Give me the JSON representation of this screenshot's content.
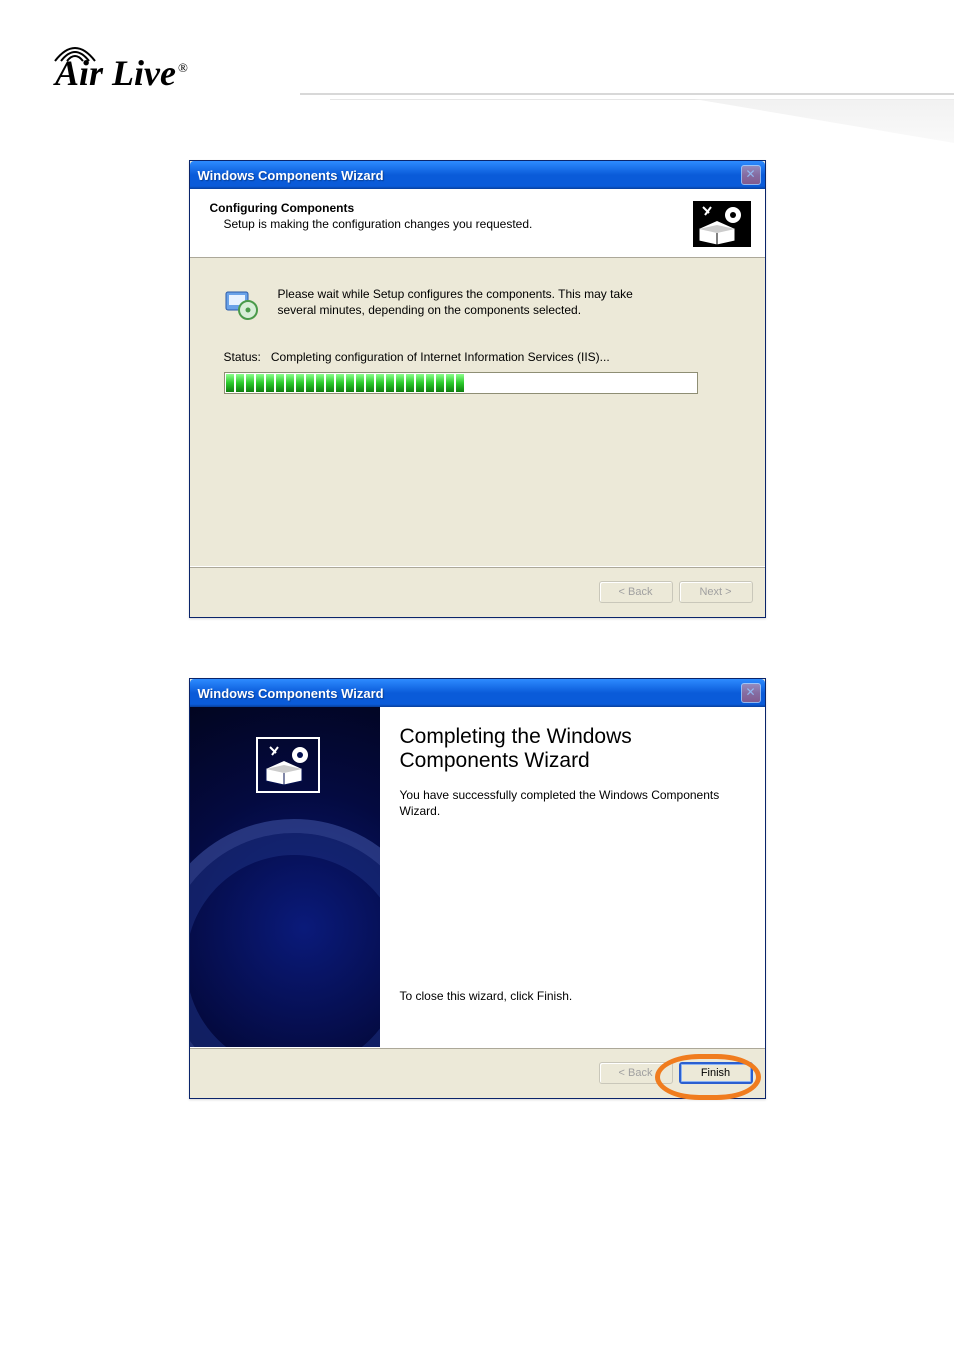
{
  "logo": {
    "text": "Air Live",
    "reg": "®"
  },
  "dialog1": {
    "title": "Windows Components Wizard",
    "header_title": "Configuring Components",
    "header_subtitle": "Setup is making the configuration changes you requested.",
    "wait_text": "Please wait while Setup configures the components. This may take several minutes, depending on the components selected.",
    "status_label": "Status:",
    "status_value": "Completing configuration of Internet Information Services (IIS)...",
    "progress_segments": 24,
    "buttons": {
      "back": "< Back",
      "next": "Next >"
    }
  },
  "dialog2": {
    "title": "Windows Components Wizard",
    "heading_line1": "Completing the Windows",
    "heading_line2": "Components Wizard",
    "body": "You have successfully completed the Windows Components Wizard.",
    "close_hint": "To close this wizard, click Finish.",
    "buttons": {
      "back": "< Back",
      "finish": "Finish"
    }
  }
}
